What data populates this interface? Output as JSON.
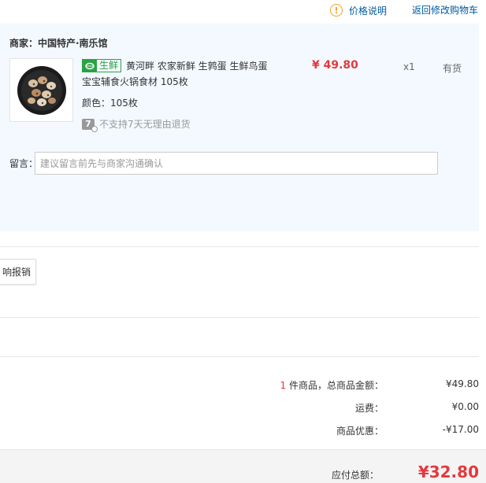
{
  "top": {
    "price_help": "价格说明",
    "back_to_cart": "返回修改购物车"
  },
  "shop": {
    "merchant": "商家：中国特产·南乐馆",
    "badge": "生鲜",
    "title_line1": "黄河畔 农家新鲜 生鹑蛋 生鲜鸟蛋",
    "title_line2": "宝宝辅食火锅食材 105枚",
    "price": "¥ 49.80",
    "qty": "x1",
    "stock": "有货",
    "color": "颜色：105枚",
    "return_policy": "不支持7天无理由退货",
    "return_icon": "7",
    "note_label": "留言：",
    "note_placeholder": "建议留言前先与商家沟通确认"
  },
  "reimburse_button": "响报销",
  "summary": {
    "count": "1",
    "count_text": " 件商品，总商品金额：",
    "goods_amount": "¥49.80",
    "shipping_label": "运费：",
    "shipping_value": "¥0.00",
    "discount_label": "商品优惠：",
    "discount_value": "-¥17.00",
    "total_label": "应付总额：",
    "total_value": "¥32.80"
  },
  "colors": {
    "accent_red": "#e4393c",
    "link_blue": "#005aa0",
    "fresh_green": "#2ba243",
    "panel_bg": "#f3f9ff"
  },
  "icons": [
    "info-icon",
    "fresh-leaf-icon",
    "no-7day-return-icon",
    "product-thumbnail"
  ]
}
